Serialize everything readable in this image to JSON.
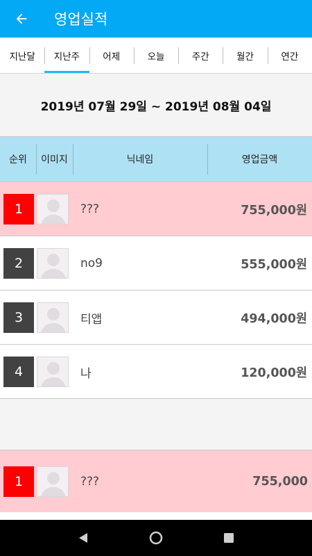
{
  "header": {
    "title": "영업실적",
    "back_icon": "arrow-left-icon"
  },
  "tabs": [
    {
      "label": "지난달",
      "active": false
    },
    {
      "label": "지난주",
      "active": true
    },
    {
      "label": "어제",
      "active": false
    },
    {
      "label": "오늘",
      "active": false
    },
    {
      "label": "주간",
      "active": false
    },
    {
      "label": "월간",
      "active": false
    },
    {
      "label": "연간",
      "active": false
    }
  ],
  "period": "2019년 07월 29일 ~ 2019년 08월 04일",
  "table": {
    "headers": {
      "rank": "순위",
      "image": "이미지",
      "nickname": "닉네임",
      "amount": "영업금액"
    },
    "rows": [
      {
        "rank": "1",
        "nickname": "???",
        "amount": "755,000원"
      },
      {
        "rank": "2",
        "nickname": "no9",
        "amount": "555,000원"
      },
      {
        "rank": "3",
        "nickname": "티앱",
        "amount": "494,000원"
      },
      {
        "rank": "4",
        "nickname": "나",
        "amount": "120,000원"
      }
    ]
  },
  "my_rank": {
    "rank": "1",
    "nickname": "???",
    "amount": "755,000"
  },
  "colors": {
    "appbar": "#03a9f4",
    "tab_indicator": "#29b6f6",
    "table_header": "#aee1f3",
    "highlight_row": "#ffccd2",
    "rank_first": "#ff0000",
    "rank_other": "#424242"
  },
  "navigation": {
    "back": "nav-back-icon",
    "home": "nav-home-icon",
    "recents": "nav-recents-icon"
  }
}
